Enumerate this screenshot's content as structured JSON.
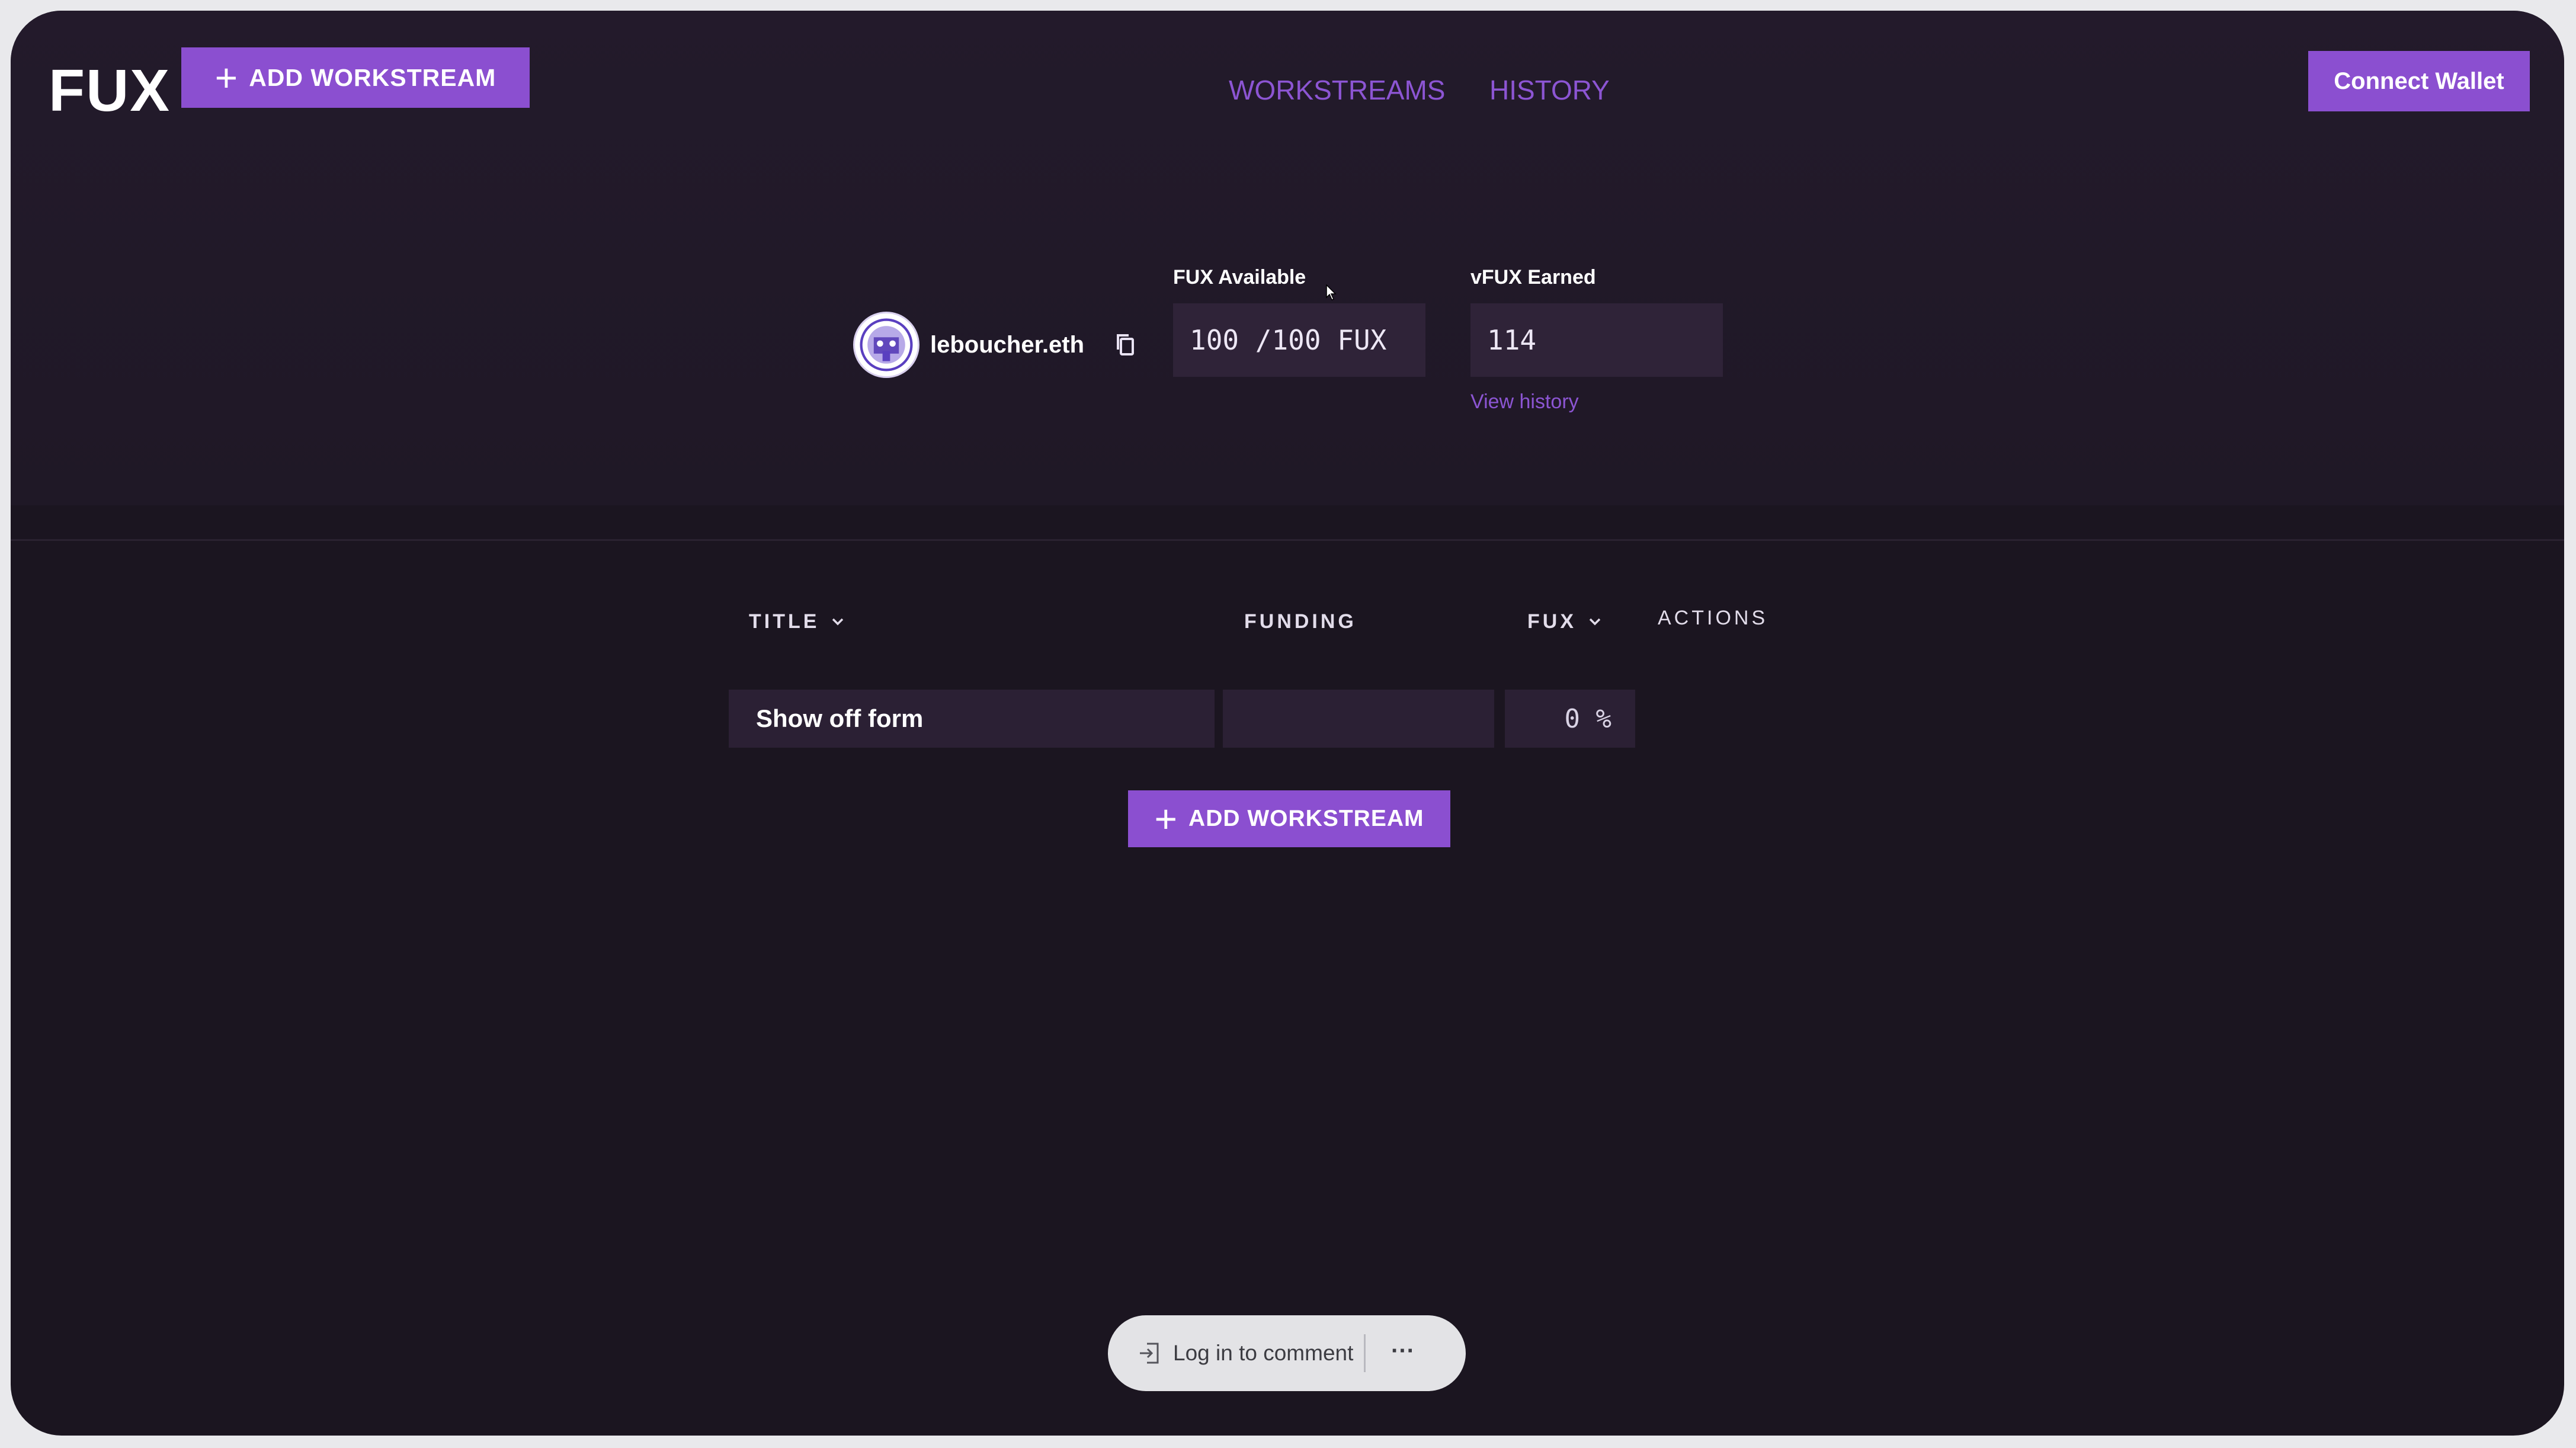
{
  "header": {
    "logo": "FUX",
    "add_workstream_label": "ADD WORKSTREAM",
    "nav": [
      "WORKSTREAMS",
      "HISTORY"
    ],
    "connect_wallet_label": "Connect Wallet"
  },
  "profile": {
    "ens_name": "leboucher.eth",
    "fux_available_label": "FUX Available",
    "fux_available_value": "100 /100 FUX",
    "vfux_earned_label": "vFUX Earned",
    "vfux_earned_value": "114",
    "view_history_link": "View history"
  },
  "table": {
    "columns": [
      "TITLE",
      "FUNDING",
      "FUX",
      "ACTIONS"
    ],
    "rows": [
      {
        "title": "Show off form",
        "funding": "",
        "fux": "0 %"
      }
    ],
    "add_workstream_label": "ADD WORKSTREAM"
  },
  "comment_bar": {
    "login_label": "Log in to comment",
    "more_label": "···"
  },
  "colors": {
    "accent": "#8b4fd0",
    "background": "#1b1520",
    "header_background": "#231a2b",
    "field_background": "#2f2338"
  },
  "icons": [
    "plus-icon",
    "copy-icon",
    "chevron-down-icon",
    "login-icon",
    "more-icon",
    "cursor-icon"
  ]
}
